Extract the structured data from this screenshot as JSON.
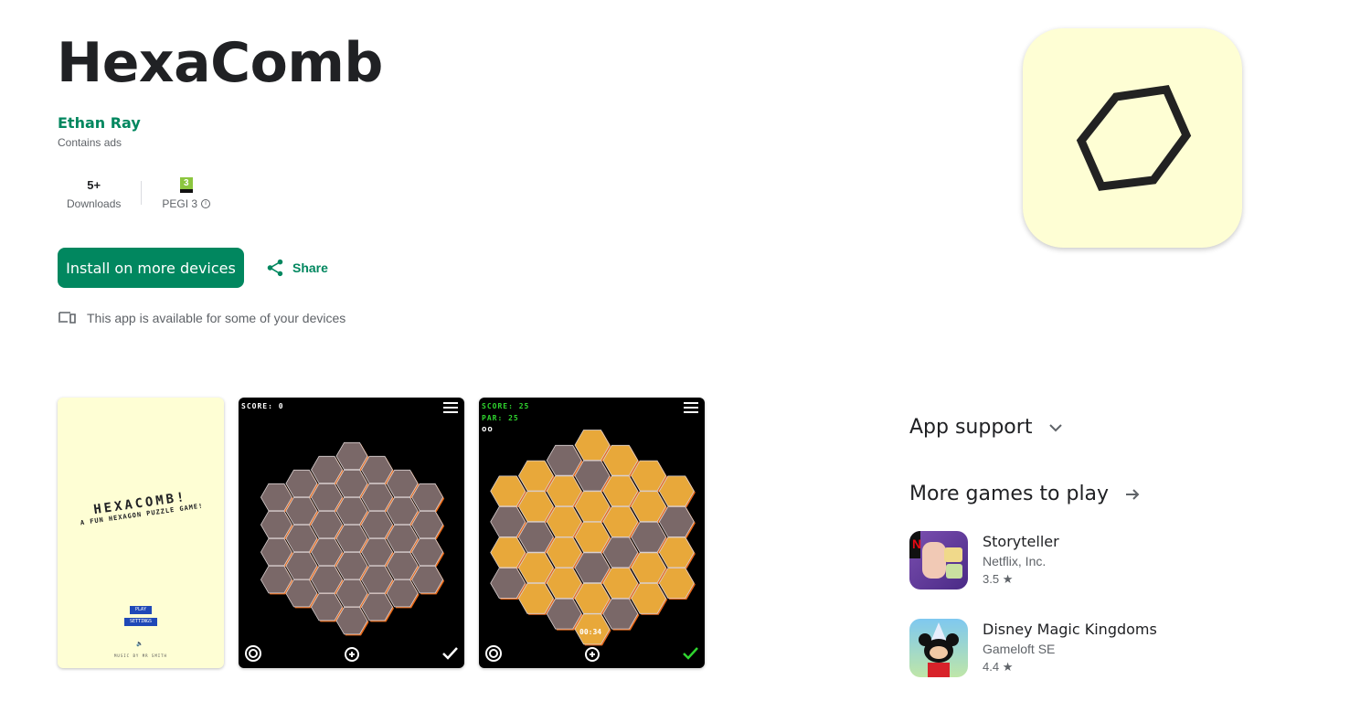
{
  "app": {
    "title": "HexaComb",
    "developer": "Ethan Ray",
    "ads_note": "Contains ads",
    "downloads_value": "5+",
    "downloads_label": "Downloads",
    "pegi_badge": "3",
    "pegi_label": "PEGI 3",
    "install_label": "Install on more devices",
    "share_label": "Share",
    "availability": "This app is available for some of your devices"
  },
  "screenshots": {
    "s1": {
      "title": "HEXACOMB!",
      "subtitle": "A FUN HEXAGON PUZZLE GAME!",
      "play": "PLAY",
      "settings": "SETTINGS",
      "music": "MUSIC BY MR SMITH"
    },
    "s2": {
      "score": "SCORE: 0"
    },
    "s3": {
      "score": "SCORE: 25",
      "par": "PAR: 25",
      "timer": "00:34"
    }
  },
  "sidebar": {
    "app_support": "App support",
    "more_games": "More games to play",
    "games": [
      {
        "name": "Storyteller",
        "developer": "Netflix, Inc.",
        "rating": "3.5"
      },
      {
        "name": "Disney Magic Kingdoms",
        "developer": "Gameloft SE",
        "rating": "4.4"
      }
    ]
  },
  "colors": {
    "accent": "#01875f",
    "icon_bg": "#fefed4",
    "hex_gray": "#7a6868",
    "hex_gold": "#e8a83a",
    "hex_edge": "#e86a1a"
  }
}
